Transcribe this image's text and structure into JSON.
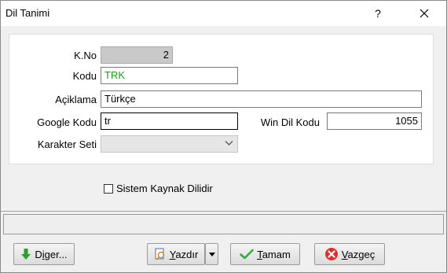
{
  "window": {
    "title": "Dil Tanimi",
    "help_label": "?"
  },
  "form": {
    "kno": {
      "label": "K.No",
      "value": "2"
    },
    "kodu": {
      "label": "Kodu",
      "value": "TRK"
    },
    "aciklama": {
      "label": "Açiklama",
      "value": "Türkçe"
    },
    "google_kodu": {
      "label": "Google Kodu",
      "value": "tr"
    },
    "win_dil_kodu": {
      "label": "Win Dil Kodu",
      "value": "1055"
    },
    "karakter_seti": {
      "label": "Karakter Seti",
      "value": ""
    }
  },
  "checkbox": {
    "label": "Sistem Kaynak Dilidir",
    "checked": false
  },
  "status": {
    "text": ""
  },
  "buttons": {
    "diger": {
      "label_pre": "D",
      "label_ul": "i",
      "label_post": "ger..."
    },
    "yazdir": {
      "label_pre": "",
      "label_ul": "Y",
      "label_post": "azdır"
    },
    "tamam": {
      "label_pre": "",
      "label_ul": "T",
      "label_post": "amam"
    },
    "vazgec": {
      "label_pre": "",
      "label_ul": "V",
      "label_post": "azgeç"
    }
  },
  "icons": {
    "diger": "green-down-arrow-icon",
    "yazdir": "print-preview-icon",
    "tamam": "green-check-icon",
    "vazgec": "red-cancel-icon"
  },
  "colors": {
    "kodu_text": "#1a9c1a",
    "disabled_bg": "#c9c9c9"
  }
}
